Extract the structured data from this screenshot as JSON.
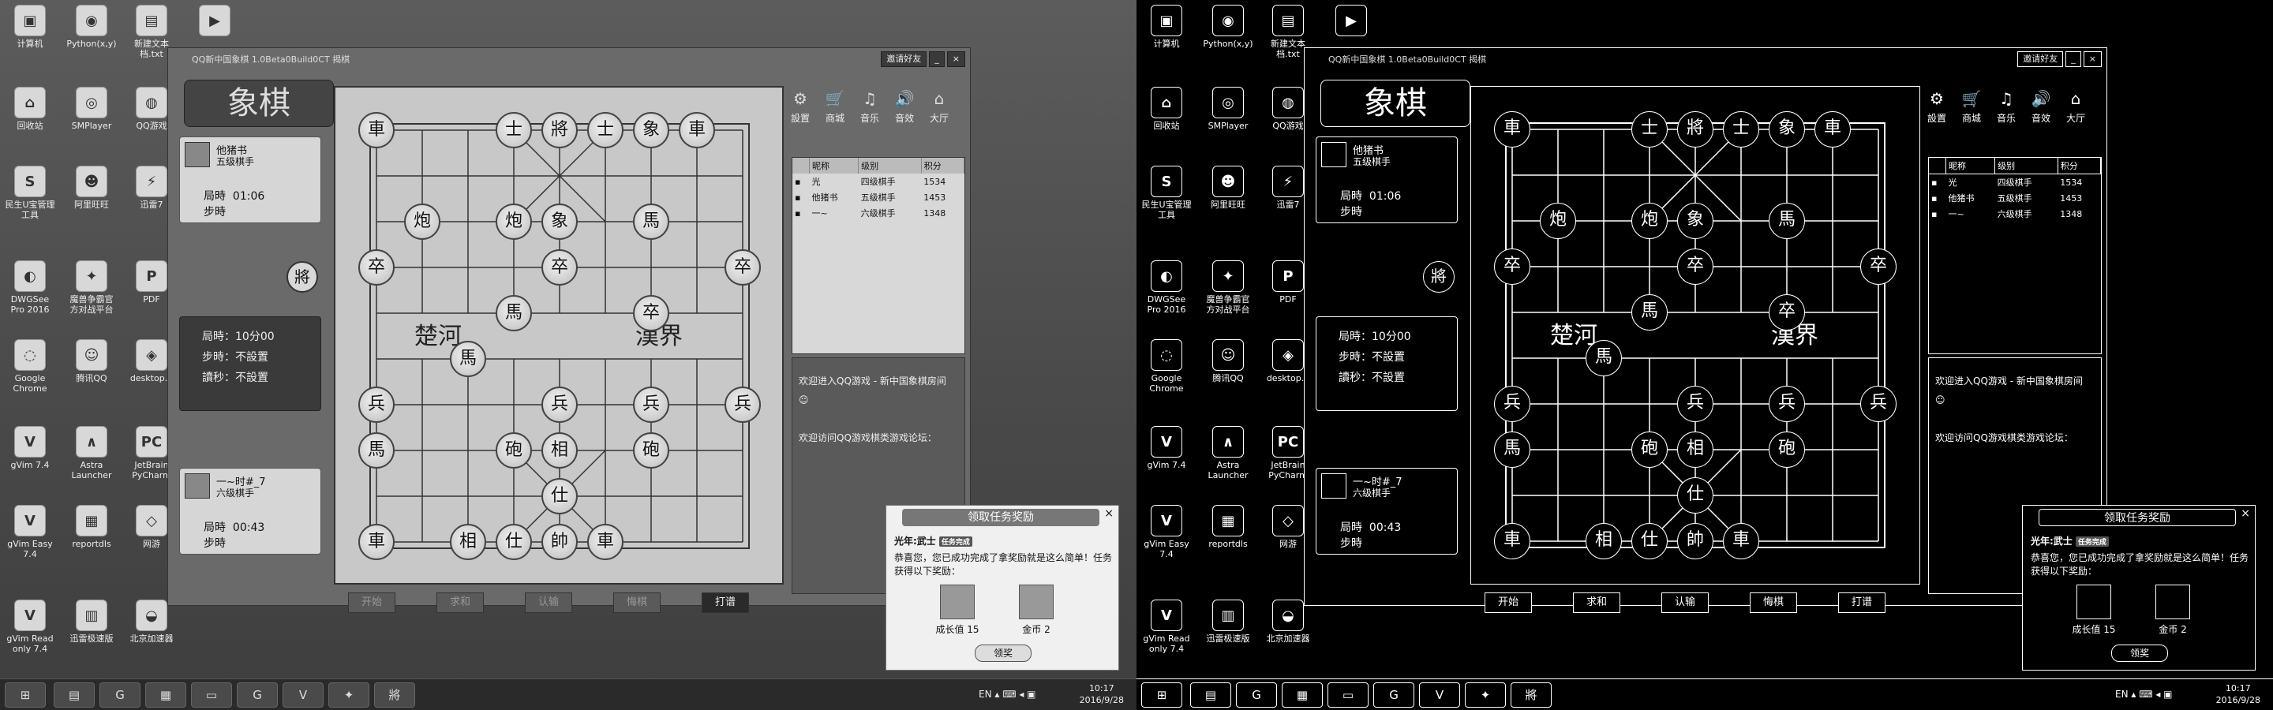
{
  "desktop": {
    "icons": [
      {
        "label": "计算机",
        "glyph": "▣"
      },
      {
        "label": "Python(x,y)",
        "glyph": "◉"
      },
      {
        "label": "新建文本\n档.txt",
        "glyph": "▤"
      },
      {
        "label": "",
        "glyph": "▶"
      },
      {
        "label": "回收站",
        "glyph": "⌂"
      },
      {
        "label": "SMPlayer",
        "glyph": "◎"
      },
      {
        "label": "QQ游戏",
        "glyph": "◍"
      },
      {
        "label": "民生U宝管理\n工具",
        "glyph": "S"
      },
      {
        "label": "阿里旺旺",
        "glyph": "☻"
      },
      {
        "label": "迅雷7",
        "glyph": "⚡"
      },
      {
        "label": "DWGSee\nPro 2016",
        "glyph": "◐"
      },
      {
        "label": "魔兽争霸官\n方对战平台",
        "glyph": "✦"
      },
      {
        "label": "PDF",
        "glyph": "P"
      },
      {
        "label": "Google\nChrome",
        "glyph": "◌"
      },
      {
        "label": "腾讯QQ",
        "glyph": "☺"
      },
      {
        "label": "desktop...",
        "glyph": "◈"
      },
      {
        "label": "gVim 7.4",
        "glyph": "V"
      },
      {
        "label": "Astra\nLauncher",
        "glyph": "∧"
      },
      {
        "label": "JetBrain\nPyCharm",
        "glyph": "PC"
      },
      {
        "label": "gVim Easy\n7.4",
        "glyph": "V"
      },
      {
        "label": "reportdls",
        "glyph": "▦"
      },
      {
        "label": "网游",
        "glyph": "◇"
      },
      {
        "label": "gVim Read\nonly 7.4",
        "glyph": "V"
      },
      {
        "label": "迅雷极速版",
        "glyph": "▥"
      },
      {
        "label": "北京加速器",
        "glyph": "◒"
      }
    ]
  },
  "window": {
    "title": "QQ新中国象棋 1.0Beta0Build0CT 揭棋",
    "invite_label": "邀请好友",
    "min_label": "_",
    "close_label": "×",
    "logo_text": "象棋"
  },
  "opponent": {
    "name": "他猪书",
    "level": "五级棋手",
    "time_label": "局時",
    "time": "01:06",
    "step_label": "步時",
    "step": ""
  },
  "self": {
    "name": "一~时#_7",
    "level": "六级棋手",
    "time_label": "局時",
    "time": "00:43",
    "step_label": "步時",
    "step": ""
  },
  "rules": {
    "line1_label": "局時：",
    "line1_value": "10分00",
    "line2_label": "步時：",
    "line2_value": "不設置",
    "line3_label": "讀秒：",
    "line3_value": "不設置"
  },
  "jiang_badge": "將",
  "board": {
    "river_left": "楚河",
    "river_right": "漢界",
    "pieces": [
      {
        "c": 0,
        "r": 0,
        "t": "車"
      },
      {
        "c": 3,
        "r": 0,
        "t": "士"
      },
      {
        "c": 4,
        "r": 0,
        "t": "將"
      },
      {
        "c": 5,
        "r": 0,
        "t": "士"
      },
      {
        "c": 6,
        "r": 0,
        "t": "象"
      },
      {
        "c": 7,
        "r": 0,
        "t": "車"
      },
      {
        "c": 1,
        "r": 2,
        "t": "炮"
      },
      {
        "c": 3,
        "r": 2,
        "t": "炮"
      },
      {
        "c": 4,
        "r": 2,
        "t": "象"
      },
      {
        "c": 6,
        "r": 2,
        "t": "馬"
      },
      {
        "c": 0,
        "r": 3,
        "t": "卒"
      },
      {
        "c": 4,
        "r": 3,
        "t": "卒"
      },
      {
        "c": 8,
        "r": 3,
        "t": "卒"
      },
      {
        "c": 3,
        "r": 4,
        "t": "馬"
      },
      {
        "c": 6,
        "r": 4,
        "t": "卒"
      },
      {
        "c": 2,
        "r": 5,
        "t": "馬"
      },
      {
        "c": 0,
        "r": 6,
        "t": "兵"
      },
      {
        "c": 4,
        "r": 6,
        "t": "兵"
      },
      {
        "c": 6,
        "r": 6,
        "t": "兵"
      },
      {
        "c": 8,
        "r": 6,
        "t": "兵"
      },
      {
        "c": 0,
        "r": 7,
        "t": "馬"
      },
      {
        "c": 3,
        "r": 7,
        "t": "砲"
      },
      {
        "c": 4,
        "r": 7,
        "t": "相"
      },
      {
        "c": 6,
        "r": 7,
        "t": "砲"
      },
      {
        "c": 4,
        "r": 8,
        "t": "仕"
      },
      {
        "c": 0,
        "r": 9,
        "t": "車"
      },
      {
        "c": 2,
        "r": 9,
        "t": "相"
      },
      {
        "c": 3,
        "r": 9,
        "t": "仕"
      },
      {
        "c": 4,
        "r": 9,
        "t": "帥"
      },
      {
        "c": 5,
        "r": 9,
        "t": "車"
      }
    ],
    "buttons": [
      {
        "label": "开始",
        "active": false
      },
      {
        "label": "求和",
        "active": false
      },
      {
        "label": "认输",
        "active": false
      },
      {
        "label": "悔棋",
        "active": false
      },
      {
        "label": "打谱",
        "active": true
      }
    ]
  },
  "tools": [
    {
      "label": "設置",
      "glyph": "⚙"
    },
    {
      "label": "商城",
      "glyph": "🛒"
    },
    {
      "label": "音乐",
      "glyph": "♫"
    },
    {
      "label": "音效",
      "glyph": "🔊"
    },
    {
      "label": "大厅",
      "glyph": "⌂"
    }
  ],
  "player_list": {
    "headers": [
      "",
      "昵称",
      "级别",
      "积分"
    ],
    "rows": [
      {
        "icon": "▪",
        "name": "光",
        "level": "四级棋手",
        "score": "1534"
      },
      {
        "icon": "▪",
        "name": "他猪书",
        "level": "五级棋手",
        "score": "1453"
      },
      {
        "icon": "▪",
        "name": "一~",
        "level": "六级棋手",
        "score": "1348"
      }
    ]
  },
  "chat": {
    "line1": "欢迎进入QQ游戏 - 新中国象棋房间",
    "line2": "欢迎访问QQ游戏棋类游戏论坛："
  },
  "popup": {
    "title": "领取任务奖励",
    "close": "×",
    "user": "光年:武士",
    "badge": "任务完成",
    "message": "恭喜您，您已成功完成了拿奖励就是这么简单！任务 获得以下奖励：",
    "reward1": "成长值 15",
    "reward2": "金币 2",
    "claim": "领奖"
  },
  "taskbar": {
    "items": [
      "⊞",
      "▤",
      "G",
      "▦",
      "▭",
      "G",
      "V",
      "✦",
      "將"
    ],
    "tray_icons": "EN ▴ ⌨ ◂ ▣",
    "time": "10:17",
    "date": "2016/9/28"
  }
}
